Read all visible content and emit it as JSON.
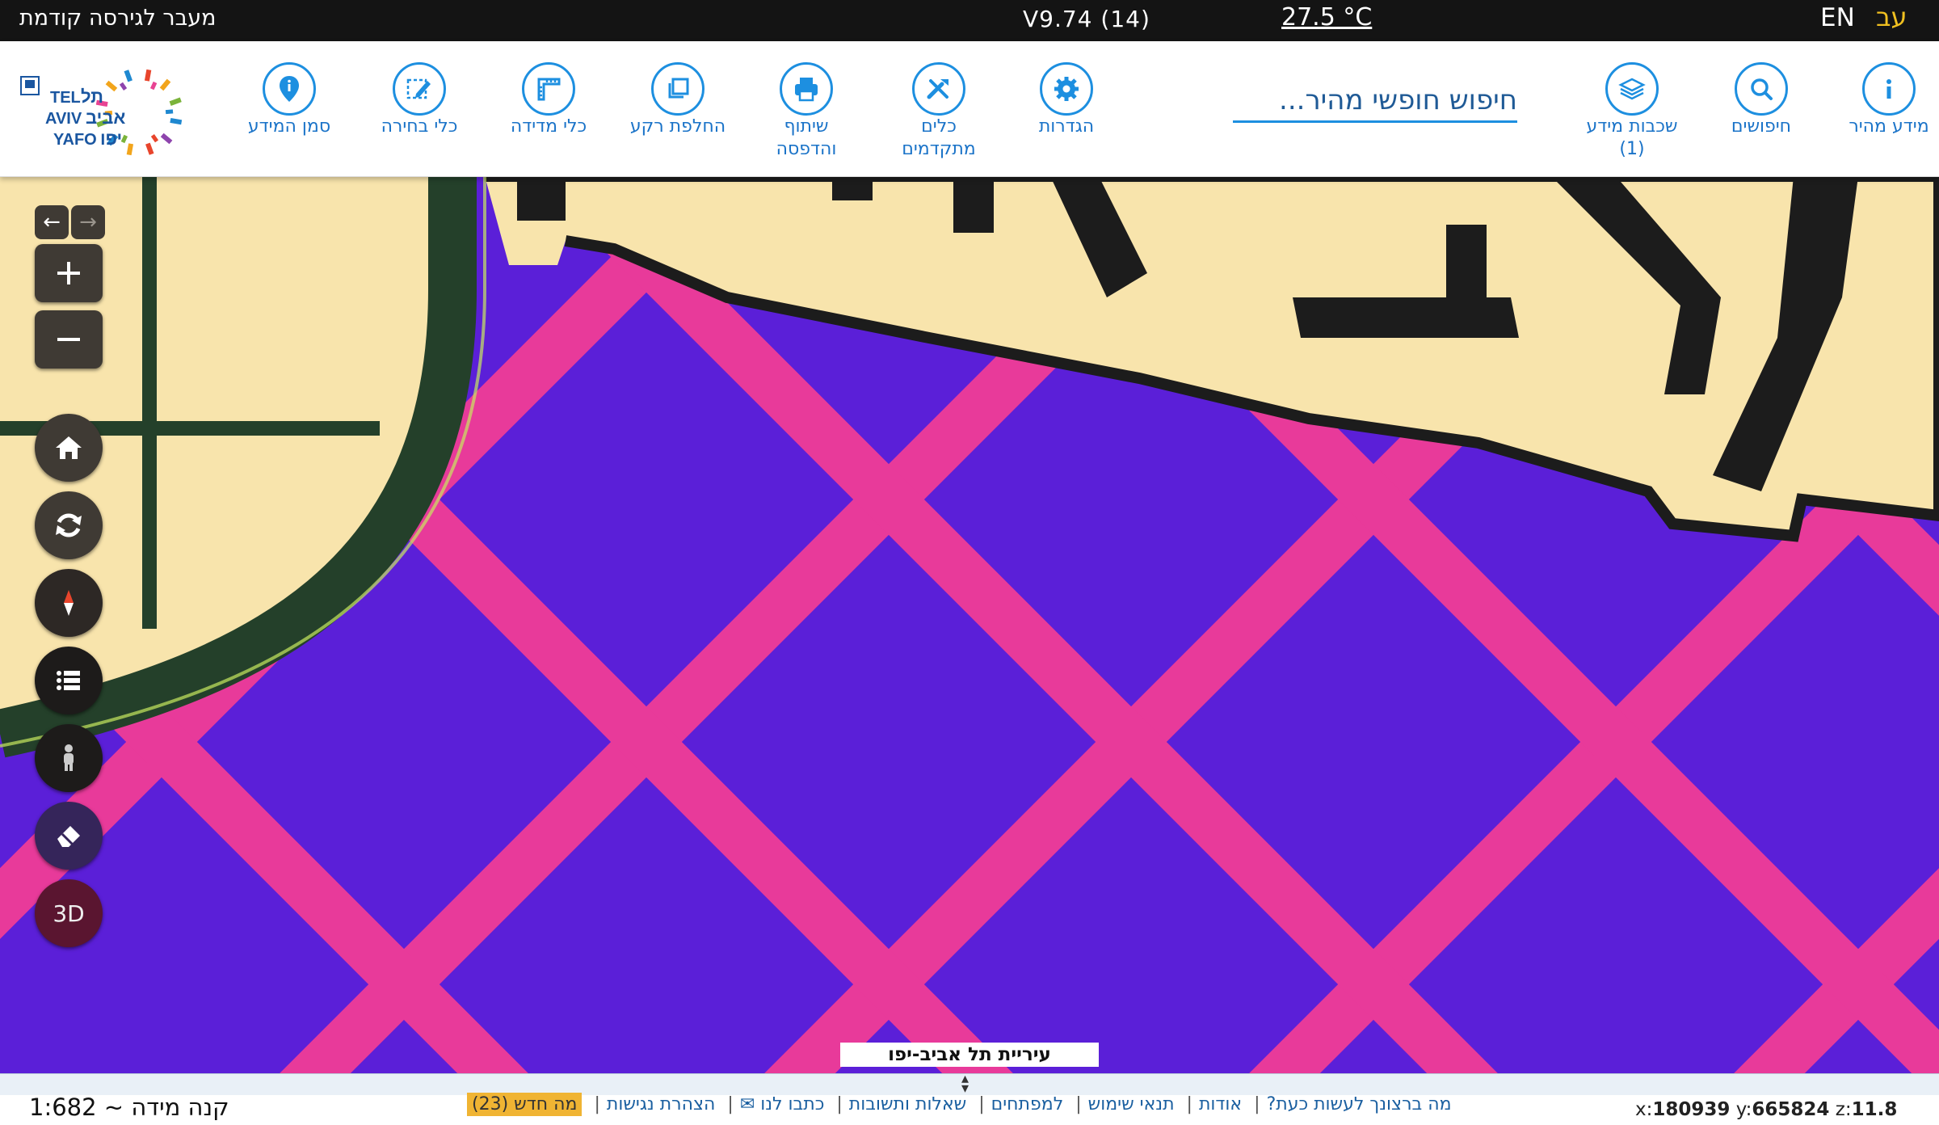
{
  "topbar": {
    "prev_version": "מעבר לגירסה קודמת",
    "version": "V9.74 (14)",
    "temperature": "27.5 °C",
    "lang_en": "EN",
    "lang_he": "עב"
  },
  "toolbar": {
    "tools": [
      {
        "label": "מידע מהיר",
        "icon": "info-icon"
      },
      {
        "label": "חיפושים",
        "icon": "search-icon"
      },
      {
        "label": "שכבות מידע (1)",
        "icon": "layers-icon"
      },
      {
        "label": "הגדרות",
        "icon": "gear-icon"
      },
      {
        "label": "כלים מתקדמים",
        "icon": "tools-icon"
      },
      {
        "label": "שיתוף והדפסה",
        "icon": "printer-icon"
      },
      {
        "label": "החלפת רקע",
        "icon": "basemap-icon"
      },
      {
        "label": "כלי מדידה",
        "icon": "ruler-icon"
      },
      {
        "label": "כלי בחירה",
        "icon": "select-icon"
      },
      {
        "label": "סמן המידע",
        "icon": "pin-icon"
      }
    ],
    "search_placeholder": "חיפוש חופשי מהיר...",
    "logo_text": {
      "tel": "TEL",
      "aviv": "AVIV",
      "yafo": "YAFO",
      "he1": "תל",
      "he2": "אביב",
      "he3": "יפו"
    }
  },
  "map": {
    "attribution": "עיריית תל אביב-יפו",
    "controls": [
      "back-arrow-icon",
      "forward-arrow-icon",
      "zoom-in-icon",
      "zoom-out-icon",
      "home-icon",
      "refresh-icon",
      "compass-icon",
      "list-icon",
      "person-icon",
      "eraser-icon"
    ],
    "btn_3d": "3D",
    "colors": {
      "fill": "#5b1fd8",
      "pink": "#e83a9a",
      "cream": "#f8e4ac",
      "green": "#24402a"
    }
  },
  "footer": {
    "scale": "קנה מידה ~ 1:682",
    "links": [
      "מה ברצונך לעשות כעת?",
      "אודות",
      "תנאי שימוש",
      "למפתחים",
      "שאלות ותשובות",
      "כתבו לנו ✉",
      "הצהרת נגישות"
    ],
    "whats_new": "מה חדש (23)",
    "coords": {
      "x": "180939",
      "y": "665824",
      "z": "11.8"
    }
  }
}
